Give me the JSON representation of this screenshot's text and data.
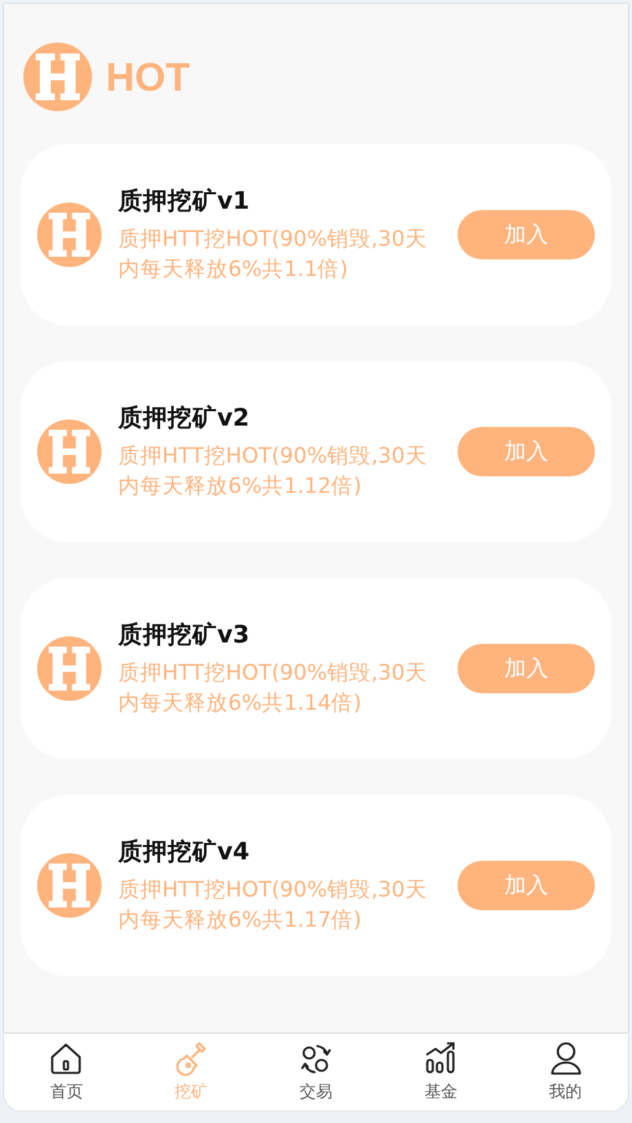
{
  "header": {
    "title": "HOT"
  },
  "products": [
    {
      "name": "质押挖矿v1",
      "description": "质押HTT挖HOT(90%销毁,30天内每天释放6%共1.1倍)",
      "button": "加入"
    },
    {
      "name": "质押挖矿v2",
      "description": "质押HTT挖HOT(90%销毁,30天内每天释放6%共1.12倍)",
      "button": "加入"
    },
    {
      "name": "质押挖矿v3",
      "description": "质押HTT挖HOT(90%销毁,30天内每天释放6%共1.14倍)",
      "button": "加入"
    },
    {
      "name": "质押挖矿v4",
      "description": "质押HTT挖HOT(90%销毁,30天内每天释放6%共1.17倍)",
      "button": "加入"
    }
  ],
  "tab_bar": [
    {
      "label": "首页",
      "kind": "home",
      "selected": false
    },
    {
      "label": "挖矿",
      "kind": "mine",
      "selected": true
    },
    {
      "label": "交易",
      "kind": "trade",
      "selected": false
    },
    {
      "label": "基金",
      "kind": "fund",
      "selected": false
    },
    {
      "label": "我的",
      "kind": "profile",
      "selected": false
    }
  ]
}
